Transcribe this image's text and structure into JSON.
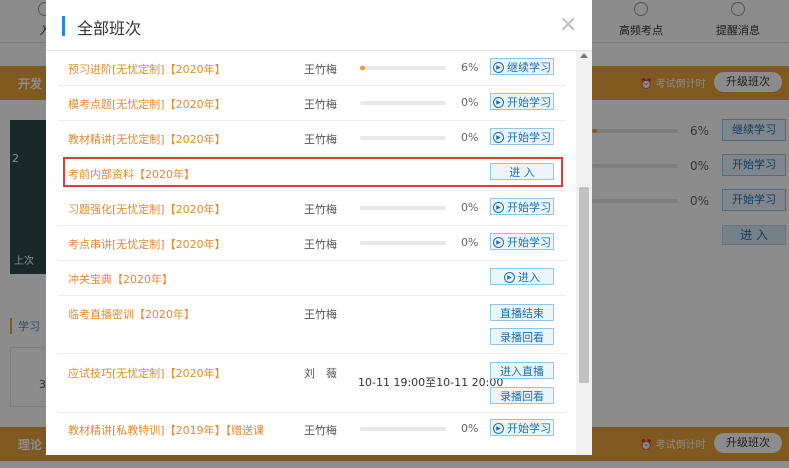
{
  "background": {
    "nav": [
      {
        "label": "入",
        "icon": "book-icon"
      },
      {
        "label": "高频考点",
        "icon": "target-icon"
      },
      {
        "label": "提醒消息",
        "icon": "message-icon"
      }
    ],
    "section1": {
      "title": "开发",
      "countdown": "⏰ 考试倒计时",
      "upgrade": "升级班次"
    },
    "section2": {
      "title": "理论",
      "countdown": "⏰ 考试倒计时",
      "upgrade": "升级班次"
    },
    "thumb_digit": "2",
    "thumb_last": "上次",
    "rows": [
      {
        "pct": "6%",
        "btn": "继续学习",
        "fill": 0.06
      },
      {
        "pct": "0%",
        "btn": "开始学习",
        "fill": 0
      },
      {
        "pct": "0%",
        "btn": "开始学习",
        "fill": 0
      }
    ],
    "enter": "进 入",
    "study_label": "学习",
    "box_char": "3"
  },
  "modal": {
    "title": "全部班次",
    "close": "×",
    "courses": [
      {
        "name": "预习进阶[无忧定制]【2020年】",
        "teacher": "王竹梅",
        "progress": 0.06,
        "pct": "6%",
        "buttons": [
          "继续学习"
        ]
      },
      {
        "name": "模考点题[无忧定制]【2020年】",
        "teacher": "王竹梅",
        "progress": 0,
        "pct": "0%",
        "buttons": [
          "开始学习"
        ]
      },
      {
        "name": "教材精讲[无忧定制]【2020年】",
        "teacher": "王竹梅",
        "progress": 0,
        "pct": "0%",
        "buttons": [
          "开始学习"
        ]
      },
      {
        "name": "考前内部资料【2020年】",
        "teacher": "",
        "buttons": [
          "进 入"
        ]
      },
      {
        "name": "习题强化[无忧定制]【2020年】",
        "teacher": "王竹梅",
        "progress": 0,
        "pct": "0%",
        "buttons": [
          "开始学习"
        ]
      },
      {
        "name": "考点串讲[无忧定制]【2020年】",
        "teacher": "王竹梅",
        "progress": 0,
        "pct": "0%",
        "buttons": [
          "开始学习"
        ]
      },
      {
        "name": "冲关宝典【2020年】",
        "teacher": "",
        "buttons": [
          "进入"
        ]
      },
      {
        "name": "临考直播密训【2020年】",
        "teacher": "王竹梅",
        "buttons": [
          "直播结束",
          "录播回看"
        ]
      },
      {
        "name": "应试技巧[无忧定制]【2020年】",
        "teacher": "刘　薇",
        "time": "10-11 19:00至10-11 20:00",
        "buttons": [
          "进入直播",
          "录播回看"
        ]
      },
      {
        "name": "教材精讲[私教特训]【2019年】【赠送课",
        "teacher": "王竹梅",
        "progress": 0,
        "pct": "0%",
        "buttons": [
          "开始学习"
        ]
      }
    ]
  }
}
